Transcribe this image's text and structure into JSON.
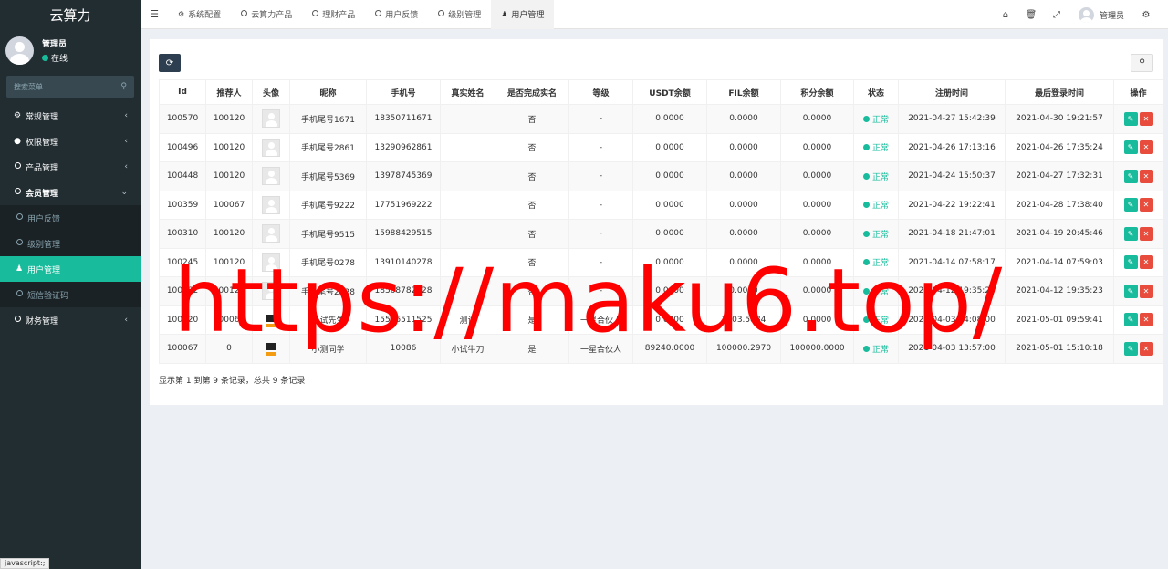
{
  "brand": "云算力",
  "user": {
    "name": "管理员",
    "status": "在线"
  },
  "sidebar_search": {
    "placeholder": "搜索菜单"
  },
  "menu": [
    {
      "label": "常规管理",
      "icon": "cogs-icon"
    },
    {
      "label": "权限管理",
      "icon": "users-icon"
    },
    {
      "label": "产品管理",
      "icon": "circle-icon"
    },
    {
      "label": "会员管理",
      "icon": "circle-icon"
    }
  ],
  "submenu": [
    {
      "label": "用户反馈"
    },
    {
      "label": "级别管理"
    },
    {
      "label": "用户管理"
    },
    {
      "label": "短信验证码"
    }
  ],
  "menu_finance": {
    "label": "财务管理"
  },
  "tabs": [
    {
      "label": "系统配置"
    },
    {
      "label": "云算力产品"
    },
    {
      "label": "理财产品"
    },
    {
      "label": "用户反馈"
    },
    {
      "label": "级别管理"
    },
    {
      "label": "用户管理"
    }
  ],
  "navbar_user": "管理员",
  "table": {
    "headers": [
      "Id",
      "推荐人",
      "头像",
      "昵称",
      "手机号",
      "真实姓名",
      "是否完成实名",
      "等级",
      "USDT余额",
      "FIL余额",
      "积分余额",
      "状态",
      "注册时间",
      "最后登录时间",
      "操作"
    ],
    "rows": [
      [
        "100570",
        "100120",
        "",
        "手机尾号1671",
        "18350711671",
        "",
        "否",
        "-",
        "0.0000",
        "0.0000",
        "0.0000",
        "正常",
        "2021-04-27 15:42:39",
        "2021-04-30 19:21:57"
      ],
      [
        "100496",
        "100120",
        "",
        "手机尾号2861",
        "13290962861",
        "",
        "否",
        "-",
        "0.0000",
        "0.0000",
        "0.0000",
        "正常",
        "2021-04-26 17:13:16",
        "2021-04-26 17:35:24"
      ],
      [
        "100448",
        "100120",
        "",
        "手机尾号5369",
        "13978745369",
        "",
        "否",
        "-",
        "0.0000",
        "0.0000",
        "0.0000",
        "正常",
        "2021-04-24 15:50:37",
        "2021-04-27 17:32:31"
      ],
      [
        "100359",
        "100067",
        "",
        "手机尾号9222",
        "17751969222",
        "",
        "否",
        "-",
        "0.0000",
        "0.0000",
        "0.0000",
        "正常",
        "2021-04-22 19:22:41",
        "2021-04-28 17:38:40"
      ],
      [
        "100310",
        "100120",
        "",
        "手机尾号9515",
        "15988429515",
        "",
        "否",
        "-",
        "0.0000",
        "0.0000",
        "0.0000",
        "正常",
        "2021-04-18 21:47:01",
        "2021-04-19 20:45:46"
      ],
      [
        "100245",
        "100120",
        "",
        "手机尾号0278",
        "13910140278",
        "",
        "否",
        "-",
        "0.0000",
        "0.0000",
        "0.0000",
        "正常",
        "2021-04-14 07:58:17",
        "2021-04-14 07:59:03"
      ],
      [
        "100182",
        "100120",
        "",
        "手机尾号2728",
        "18568782728",
        "",
        "否",
        "-",
        "0.0000",
        "0.0000",
        "0.0000",
        "正常",
        "2021-04-12 19:35:23",
        "2021-04-12 19:35:23"
      ],
      [
        "100120",
        "100067",
        "",
        "小试先生",
        "15556511525",
        "测试",
        "是",
        "一星合伙人",
        "0.0000",
        "1003.5884",
        "0.0000",
        "正常",
        "2021-04-03 14:08:00",
        "2021-05-01 09:59:41"
      ],
      [
        "100067",
        "0",
        "",
        "小测同学",
        "10086",
        "小试牛刀",
        "是",
        "一星合伙人",
        "89240.0000",
        "100000.2970",
        "100000.0000",
        "正常",
        "2021-04-03 13:57:00",
        "2021-05-01 15:10:18"
      ]
    ]
  },
  "pager_info": "显示第 1 到第 9 条记录，总共 9 条记录",
  "js_status": "javascript:;",
  "watermark": "https://maku6.top/"
}
